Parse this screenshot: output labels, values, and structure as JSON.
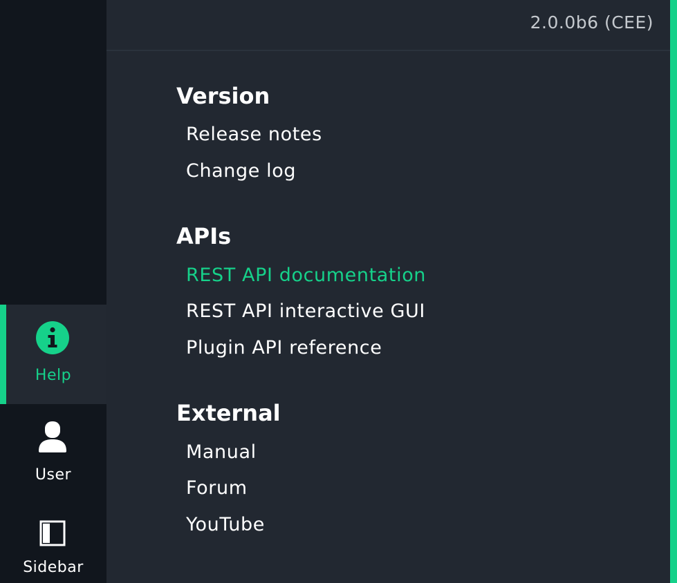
{
  "header": {
    "version": "2.0.0b6 (CEE)"
  },
  "nav": {
    "help_label": "Help",
    "user_label": "User",
    "sidebar_label": "Sidebar",
    "active_item": "Help"
  },
  "menu": {
    "version_section": {
      "title": "Version",
      "items": [
        "Release notes",
        "Change log"
      ]
    },
    "apis_section": {
      "title": "APIs",
      "items": [
        "REST API documentation",
        "REST API interactive GUI",
        "Plugin API reference"
      ]
    },
    "external_section": {
      "title": "External",
      "items": [
        "Manual",
        "Forum",
        "YouTube"
      ]
    },
    "highlighted_item": "REST API documentation"
  },
  "colors": {
    "accent": "#16d18a",
    "rail_background": "#11161d",
    "panel_background": "#222831",
    "text": "#ffffff",
    "version_text": "#c5c9ce"
  },
  "icons": {
    "help": "info-circle-icon",
    "user": "user-icon",
    "sidebar": "sidebar-toggle-icon"
  }
}
